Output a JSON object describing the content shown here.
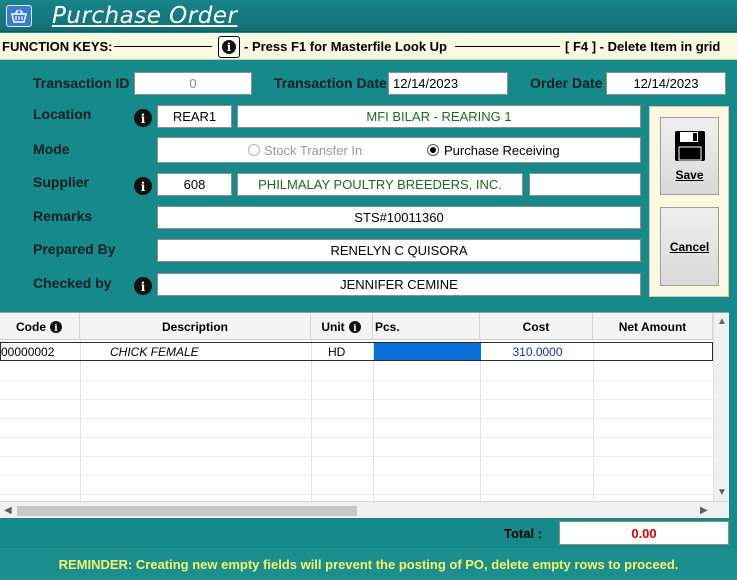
{
  "window": {
    "title": "Purchase Order"
  },
  "function_keys": {
    "label": "FUNCTION KEYS:",
    "f1_hint": "- Press F1 for Masterfile Look Up",
    "f4_hint": "[ F4 ] - Delete Item in grid"
  },
  "header": {
    "transaction_id_label": "Transaction ID",
    "transaction_id": "0",
    "transaction_date_label": "Transaction Date",
    "transaction_date": "12/14/2023",
    "order_date_label": "Order Date",
    "order_date": "12/14/2023"
  },
  "form": {
    "location_label": "Location",
    "location_code": "REAR1",
    "location_name": "MFI BILAR - REARING 1",
    "mode_label": "Mode",
    "mode_options": [
      {
        "label": "Stock Transfer In",
        "selected": false,
        "enabled": false
      },
      {
        "label": "Purchase Receiving",
        "selected": true,
        "enabled": true
      }
    ],
    "supplier_label": "Supplier",
    "supplier_code": "608",
    "supplier_name": "PHILMALAY POULTRY BREEDERS, INC.",
    "supplier_extra": "",
    "remarks_label": "Remarks",
    "remarks": "STS#10011360",
    "prepared_by_label": "Prepared By",
    "prepared_by": "RENELYN C QUISORA",
    "checked_by_label": "Checked by",
    "checked_by": "JENNIFER CEMINE"
  },
  "actions": {
    "save_label": "Save",
    "cancel_label": "Cancel"
  },
  "grid": {
    "columns": [
      "Code",
      "Description",
      "Unit",
      "Pcs.",
      "Cost",
      "Net Amount"
    ],
    "rows": [
      {
        "code": "00000002",
        "description": "CHICK FEMALE",
        "unit": "HD",
        "pcs": "",
        "cost": "310.0000",
        "net_amount": ""
      }
    ]
  },
  "totals": {
    "label": "Total :",
    "value": "0.00"
  },
  "reminder": "REMINDER: Creating new empty fields will prevent the posting of PO, delete empty rows to proceed.",
  "colors": {
    "teal": "#168a8a",
    "panel_cream": "#fbf8e2",
    "reminder_text": "#f3f36b",
    "total_red": "#e00000",
    "selection_blue": "#0a6ed8"
  }
}
